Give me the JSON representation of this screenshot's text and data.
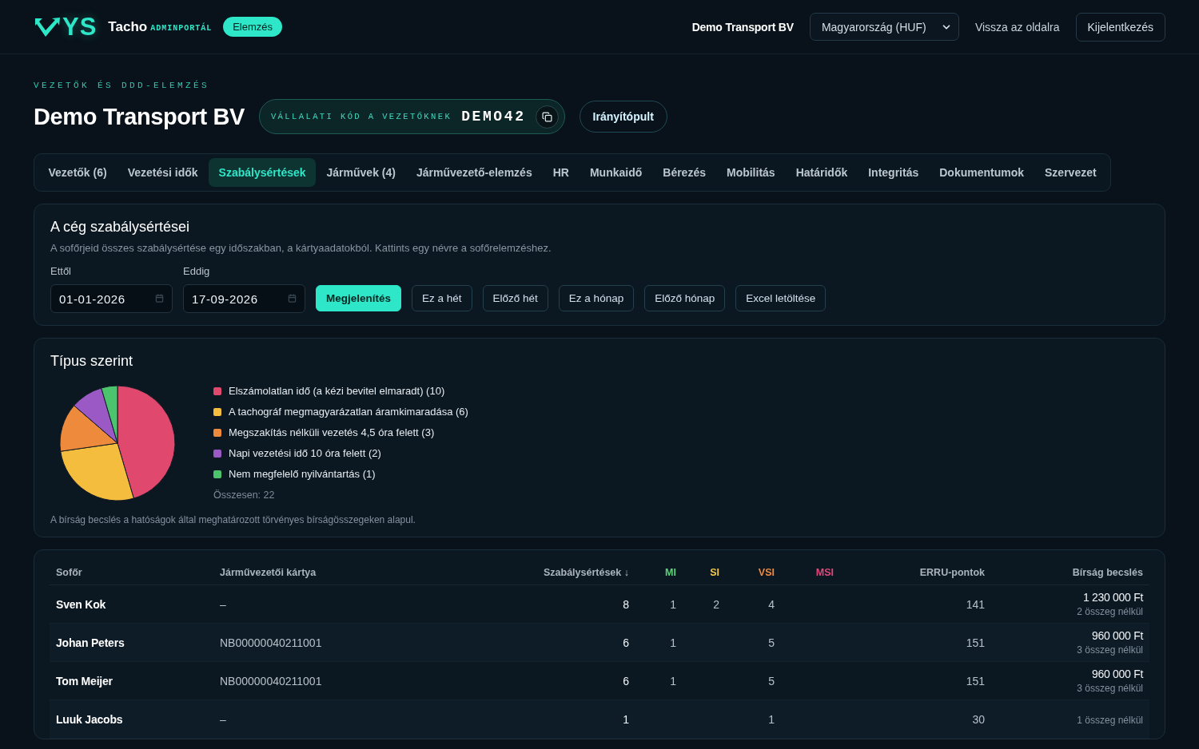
{
  "header": {
    "logo_text": "YS",
    "app_name": "Tacho",
    "app_tag": "ADMINPORTÁL",
    "badge": "Elemzés",
    "company": "Demo Transport BV",
    "currency_select": "Magyarország (HUF)",
    "back_link": "Vissza az oldalra",
    "logout_button": "Kijelentkezés"
  },
  "page": {
    "eyebrow": "VEZETŐK ÉS DDD-ELEMZÉS",
    "title": "Demo Transport BV",
    "company_code": {
      "label": "VÁLLALATI KÓD A VEZETŐKNEK",
      "code": "DEMO42"
    },
    "dashboard_button": "Irányítópult"
  },
  "tabs": [
    {
      "label": "Vezetők (6)",
      "selected": false
    },
    {
      "label": "Vezetési idők",
      "selected": false
    },
    {
      "label": "Szabálysértések",
      "selected": true
    },
    {
      "label": "Járművek (4)",
      "selected": false
    },
    {
      "label": "Járművezető-elemzés",
      "selected": false
    },
    {
      "label": "HR",
      "selected": false
    },
    {
      "label": "Munkaidő",
      "selected": false
    },
    {
      "label": "Bérezés",
      "selected": false
    },
    {
      "label": "Mobilitás",
      "selected": false
    },
    {
      "label": "Határidők",
      "selected": false
    },
    {
      "label": "Integritás",
      "selected": false
    },
    {
      "label": "Dokumentumok",
      "selected": false
    },
    {
      "label": "Szervezet",
      "selected": false
    }
  ],
  "violations_filter": {
    "title": "A cég szabálysértései",
    "description": "A sofőrjeid összes szabálysértése egy időszakban, a kártyaadatokból. Kattints egy névre a sofőrelemzéshez.",
    "from": {
      "label": "Ettől",
      "value": "01-01-2026"
    },
    "to": {
      "label": "Eddig",
      "value": "17-09-2026"
    },
    "buttons": [
      {
        "label": "Megjelenítés",
        "kind": "primary"
      },
      {
        "label": "Ez a hét",
        "kind": "outline"
      },
      {
        "label": "Előző hét",
        "kind": "outline"
      },
      {
        "label": "Ez a hónap",
        "kind": "outline"
      },
      {
        "label": "Előző hónap",
        "kind": "outline"
      },
      {
        "label": "Excel letöltése",
        "kind": "outline"
      }
    ]
  },
  "by_type": {
    "title": "Típus szerint",
    "legend": [
      {
        "color": "#e0496d"
      },
      {
        "color": "#f5bd3e"
      },
      {
        "color": "#ee8a3c"
      },
      {
        "color": "#9b59c6"
      },
      {
        "color": "#4cc46d"
      }
    ],
    "chart_data": {
      "type": "pie",
      "categories": [
        "Elszámolatlan idő (a kézi bevitel elmaradt) (10)",
        "A tachográf megmagyarázatlan áramkimaradása (6)",
        "Megszakítás nélküli vezetés 4,5 óra felett (3)",
        "Napi vezetési idő 10 óra felett (2)",
        "Nem megfelelő nyilvántartás (1)"
      ],
      "values": [
        10,
        6,
        3,
        2,
        1
      ]
    },
    "total": "Összesen: 22",
    "note": "A bírság becslés a hatóságok által meghatározott törvényes bírságösszegeken alapul."
  },
  "table": {
    "columns": [
      {
        "label": "Sofőr"
      },
      {
        "label": "Járművezetői kártya"
      },
      {
        "label": "Szabálysértések ↓"
      },
      {
        "label": "MI",
        "color": "#5fd07a"
      },
      {
        "label": "SI",
        "color": "#f2c94c"
      },
      {
        "label": "VSI",
        "color": "#f08a3e"
      },
      {
        "label": "MSI",
        "color": "#e0487c"
      },
      {
        "label": "ERRU-pontok"
      },
      {
        "label": "Bírság becslés"
      }
    ],
    "rows": [
      {
        "driver": "Sven Kok",
        "card": "–",
        "violations": "8",
        "mi": "1",
        "si": "2",
        "vsi": "4",
        "erru": "141",
        "fine": "1 230 000 Ft",
        "fine_note": "2 összeg nélkül"
      },
      {
        "driver": "Johan Peters",
        "card": "NB00000040211001",
        "violations": "6",
        "mi": "1",
        "vsi": "5",
        "erru": "151",
        "fine": "960 000 Ft",
        "fine_note": "3 összeg nélkül"
      },
      {
        "driver": "Tom Meijer",
        "card": "NB00000040211001",
        "violations": "6",
        "mi": "1",
        "vsi": "5",
        "erru": "151",
        "fine": "960 000 Ft",
        "fine_note": "3 összeg nélkül"
      },
      {
        "driver": "Luuk Jacobs",
        "card": "–",
        "violations": "1",
        "vsi": "1",
        "erru": "30",
        "fine_note": "1 összeg nélkül"
      }
    ]
  }
}
